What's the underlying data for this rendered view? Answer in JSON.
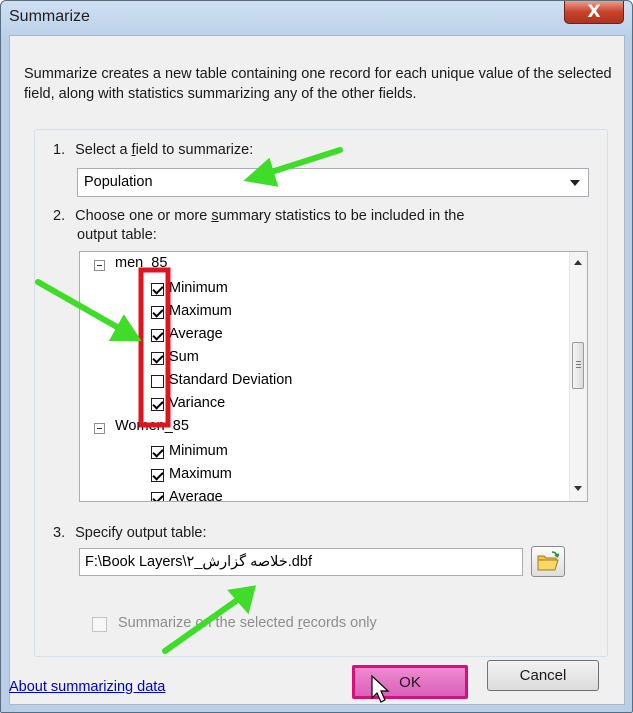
{
  "window": {
    "title": "Summarize",
    "close_glyph": "X"
  },
  "description": "Summarize creates a new table containing one record for each unique value of the selected field, along with statistics summarizing any of the other fields.",
  "step1": {
    "number": "1.",
    "label_pre": "Select a ",
    "label_accel": "f",
    "label_post": "ield to summarize:",
    "selected_field": "Population"
  },
  "step2": {
    "number": "2.",
    "label_line1_pre": "Choose one or more ",
    "label_line1_accel": "s",
    "label_line1_post": "ummary statistics to be included in the",
    "label_line2": "output table:",
    "fields": [
      {
        "name": "men_85",
        "stats": [
          {
            "label": "Minimum",
            "checked": true
          },
          {
            "label": "Maximum",
            "checked": true
          },
          {
            "label": "Average",
            "checked": true
          },
          {
            "label": "Sum",
            "checked": true
          },
          {
            "label": "Standard Deviation",
            "checked": false
          },
          {
            "label": "Variance",
            "checked": true
          }
        ]
      },
      {
        "name": "Women_85",
        "stats": [
          {
            "label": "Minimum",
            "checked": true
          },
          {
            "label": "Maximum",
            "checked": true
          },
          {
            "label": "Average",
            "checked": true
          }
        ]
      }
    ]
  },
  "step3": {
    "number": "3.",
    "label": "Specify output table:",
    "output_path": "F:\\Book Layers\\خلاصه گزارش_۲.dbf"
  },
  "selected_only": {
    "label_pre": "Summarize on the selected ",
    "label_accel": "r",
    "label_post": "ecords only",
    "checked": false
  },
  "footer": {
    "about_link": "About summarizing data",
    "ok_label": "OK",
    "cancel_label": "Cancel"
  },
  "icons": {
    "close": "close-icon",
    "dropdown": "chevron-down-icon",
    "folder": "open-folder-icon",
    "cursor": "mouse-pointer-icon"
  },
  "colors": {
    "annotation_arrow": "#3fdc2a",
    "highlight_box": "#e0141e",
    "ok_highlight": "#d60f7a",
    "link": "#0000cc"
  }
}
